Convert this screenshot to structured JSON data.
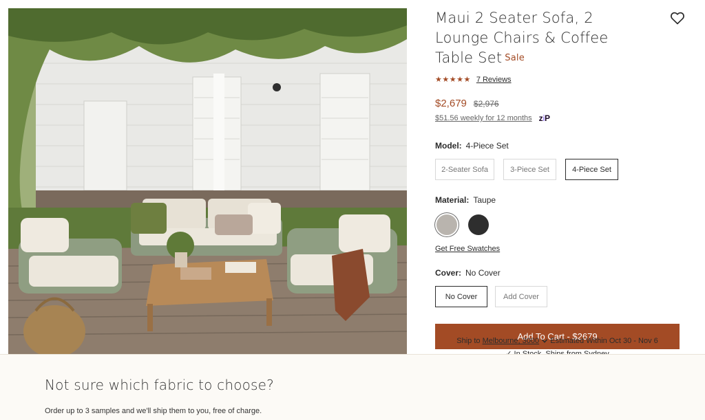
{
  "product": {
    "title": "Maui 2 Seater Sofa, 2 Lounge Chairs & Coffee Table Set",
    "sale_badge": "Sale",
    "stars": "★★★★★",
    "reviews_link": "7 Reviews",
    "price": "$2,679",
    "original_price": "$2,976",
    "installment": "$51.56 weekly for 12 months",
    "installment_provider_pre": "z",
    "installment_provider_mid": "i",
    "installment_provider_post": "P"
  },
  "options": {
    "model": {
      "label": "Model:",
      "selected": "4-Piece Set",
      "choices": [
        "2-Seater Sofa",
        "3-Piece Set",
        "4-Piece Set"
      ]
    },
    "material": {
      "label": "Material:",
      "selected": "Taupe",
      "swatch_colors": [
        "#b9b4ae",
        "#2e2e2e"
      ],
      "swatches_link": "Get Free Swatches"
    },
    "cover": {
      "label": "Cover:",
      "selected": "No Cover",
      "choices": [
        "No Cover",
        "Add Cover"
      ]
    }
  },
  "cart": {
    "button": "Add To Cart - $2679"
  },
  "shipping": {
    "prefix": "Ship to",
    "location": "Melbourne, 3000",
    "estimate": "Estimated Within Oct 30 - Nov 6",
    "stock": "In Stock. Ships from Sydney"
  },
  "banner": {
    "heading": "Not sure which fabric to choose?",
    "text": "Order up to 3 samples and we'll ship them to you, free of charge."
  },
  "colors": {
    "accent": "#a34b25",
    "text": "#2b2b2b",
    "banner_bg": "#fcfaf6"
  },
  "icons": {
    "wishlist": "heart-icon",
    "location_dropdown": "chevron-down-icon",
    "stock": "check-icon"
  }
}
